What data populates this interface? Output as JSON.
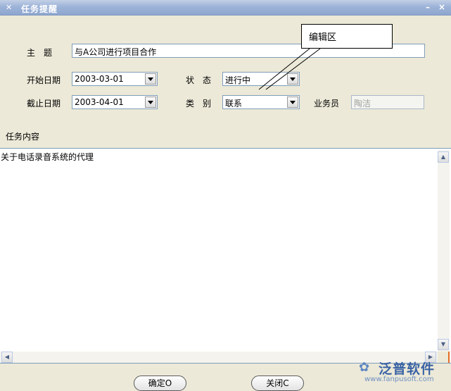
{
  "window": {
    "title": "任务提醒",
    "icon": "app-icon",
    "min_label": "–",
    "close_label": "×"
  },
  "form": {
    "subject_label": "主　题",
    "subject_value": "与A公司进行项目合作",
    "start_label": "开始日期",
    "start_value": "2003-03-01",
    "end_label": "截止日期",
    "end_value": "2003-04-01",
    "status_label": "状　态",
    "status_value": "进行中",
    "category_label": "类　别",
    "category_value": "联系",
    "staff_label": "业务员",
    "staff_value": "陶洁"
  },
  "callout": {
    "text": "编辑区"
  },
  "content": {
    "label": "任务内容",
    "text": "关于电话录音系统的代理"
  },
  "buttons": {
    "ok": "确定O",
    "close": "关闭C"
  },
  "logo": {
    "name": "泛普软件",
    "url": "www.fanpusoft.com"
  }
}
